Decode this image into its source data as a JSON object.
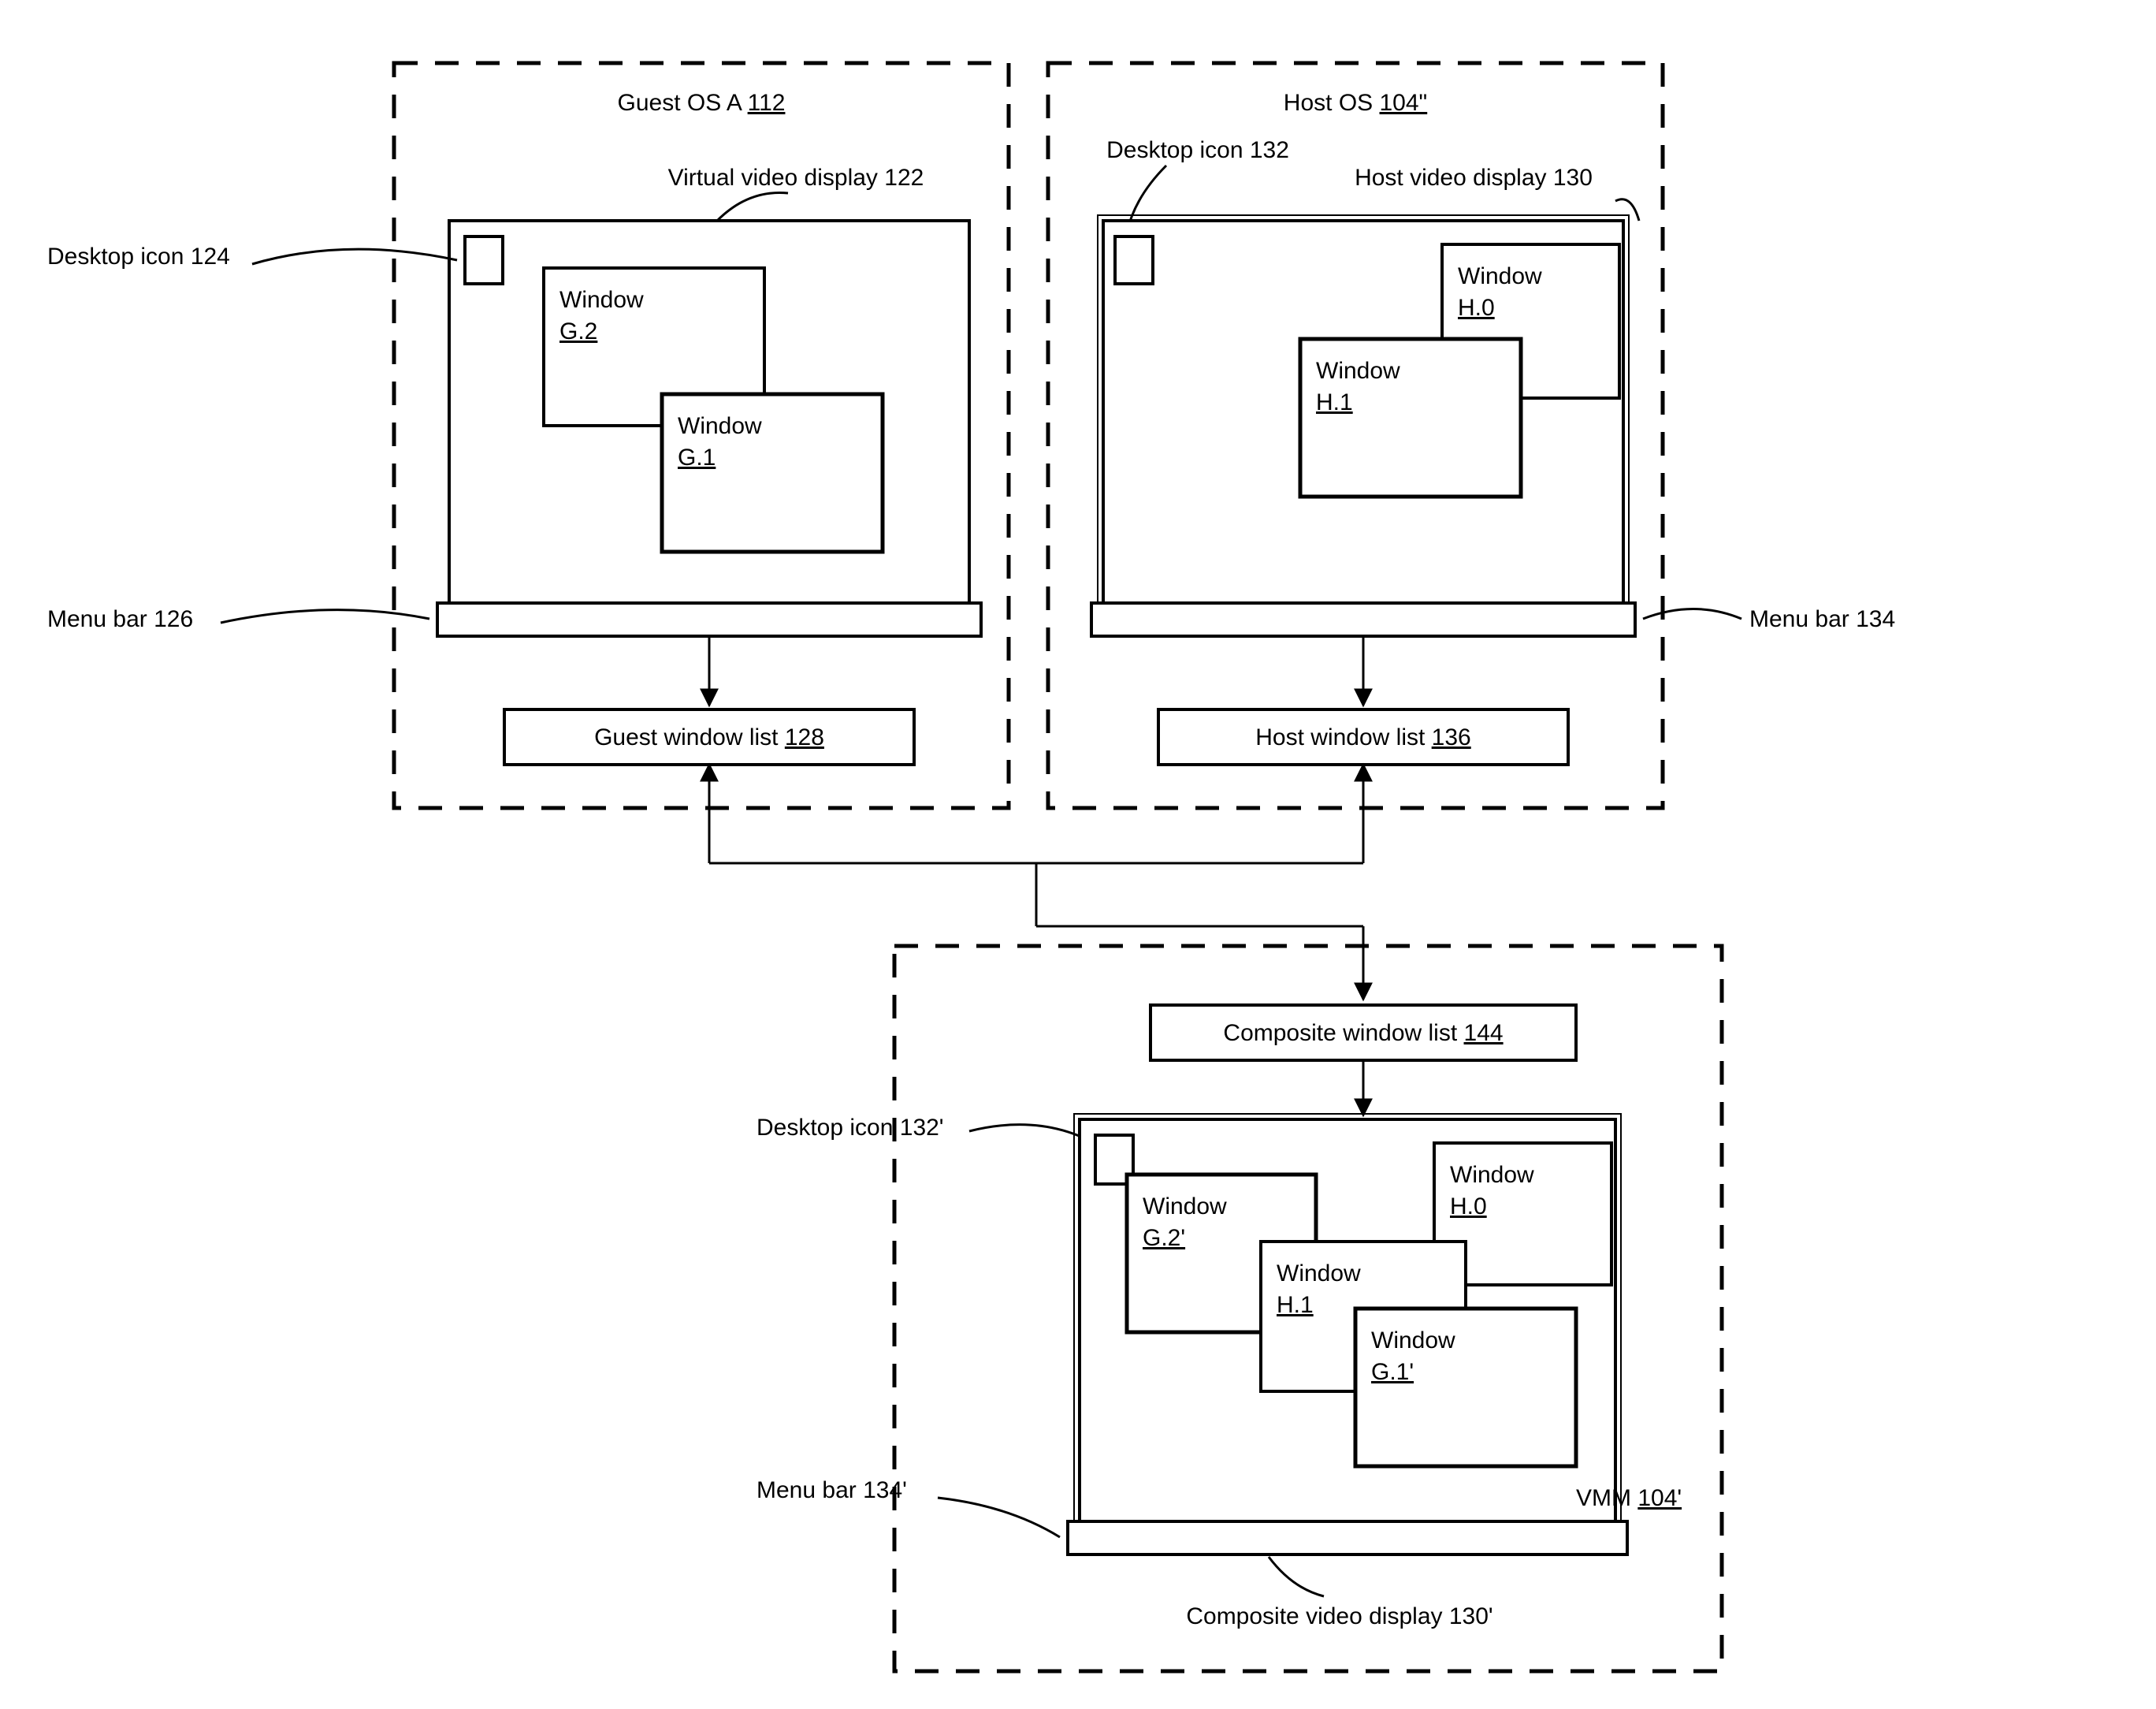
{
  "guest": {
    "title_pre": "Guest OS A ",
    "title_post_u": "112",
    "display_label": "Virtual video display 122",
    "icon_label": "Desktop icon 124",
    "win_g2_pre": "Window",
    "win_g2_post_u": "G.2",
    "win_g1_pre": "Window",
    "win_g1_post_u": "G.1",
    "menu_label": "Menu bar 126",
    "list_pre": "Guest window list ",
    "list_post_u": "128"
  },
  "host": {
    "title_pre": "Host OS ",
    "title_post_u": "104\"",
    "display_label": "Host video display 130",
    "icon_label": "Desktop icon 132",
    "win_h0_pre": "Window",
    "win_h0_post_u": "H.0",
    "win_h1_pre": "Window",
    "win_h1_post_u": "H.1",
    "menu_label": "Menu bar 134",
    "list_pre": "Host window list ",
    "list_post_u": "136"
  },
  "vmm": {
    "title_pre": "VMM ",
    "title_post_u": "104'",
    "display_label": "Composite video display 130'",
    "icon_label": "Desktop icon 132'",
    "win_g2_pre": "Window",
    "win_g2_post_u": "G.2'",
    "win_h0_pre": "Window",
    "win_h0_post_u": "H.0",
    "win_h1_pre": "Window",
    "win_h1_post_u": "H.1",
    "win_g1_pre": "Window",
    "win_g1_post_u": "G.1'",
    "menu_label": "Menu bar 134'",
    "list_pre": "Composite window list ",
    "list_post_u": "144"
  }
}
